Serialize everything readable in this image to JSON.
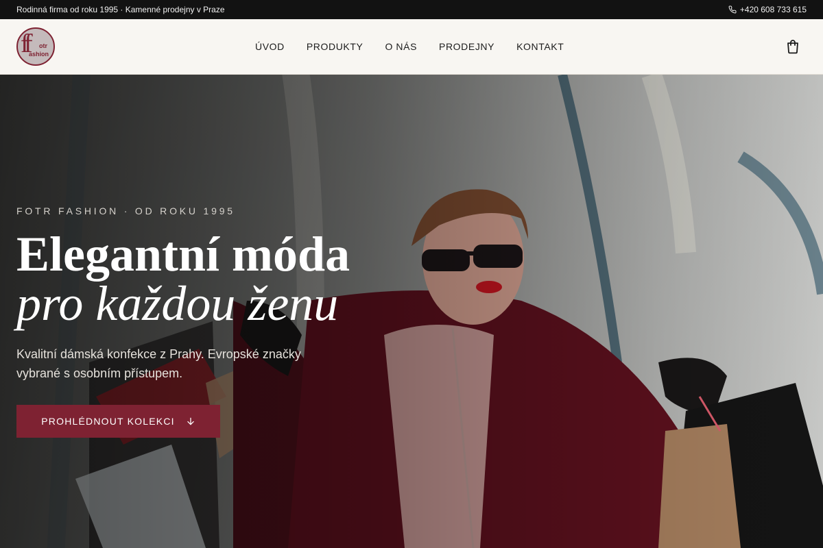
{
  "topbar": {
    "tagline": "Rodinná firma od roku 1995 · Kamenné prodejny v Praze",
    "phone": "+420 608 733 615"
  },
  "logo": {
    "mark": "ff",
    "line1": "otr",
    "line2": "ashion"
  },
  "nav": {
    "items": [
      "ÚVOD",
      "PRODUKTY",
      "O NÁS",
      "PRODEJNY",
      "KONTAKT"
    ]
  },
  "header": {
    "cart_icon": "shopping-bag-icon"
  },
  "hero": {
    "eyebrow": "FOTR FASHION · OD ROKU 1995",
    "title_line1": "Elegantní móda",
    "title_line2": "pro každou ženu",
    "subtitle": "Kvalitní dámská konfekce z Prahy. Evropské značky vybrané s osobním přístupem.",
    "cta_label": "PROHLÉDNOUT KOLEKCI",
    "cta_icon": "arrow-down-icon",
    "image": "woman-shopping-bags-photo"
  },
  "colors": {
    "brand": "#7e2232",
    "topbar_bg": "#121212",
    "header_bg": "#f8f6f2"
  }
}
